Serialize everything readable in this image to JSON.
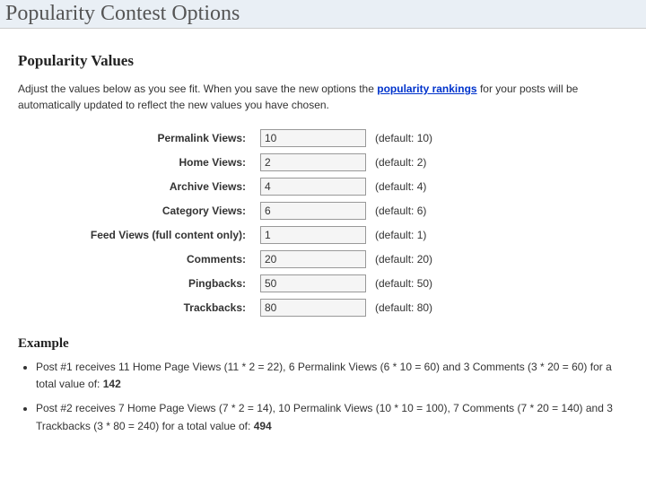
{
  "page_title": "Popularity Contest Options",
  "section_heading": "Popularity Values",
  "intro_pre": "Adjust the values below as you see fit. When you save the new options the ",
  "intro_link": "popularity rankings",
  "intro_post": " for your posts will be automatically updated to reflect the new values you have chosen.",
  "fields": {
    "permalink": {
      "label": "Permalink Views:",
      "value": "10",
      "default": "(default: 10)"
    },
    "home": {
      "label": "Home Views:",
      "value": "2",
      "default": "(default: 2)"
    },
    "archive": {
      "label": "Archive Views:",
      "value": "4",
      "default": "(default: 4)"
    },
    "category": {
      "label": "Category Views:",
      "value": "6",
      "default": "(default: 6)"
    },
    "feed": {
      "label": "Feed Views (full content only):",
      "value": "1",
      "default": "(default: 1)"
    },
    "comments": {
      "label": "Comments:",
      "value": "20",
      "default": "(default: 20)"
    },
    "pingbacks": {
      "label": "Pingbacks:",
      "value": "50",
      "default": "(default: 50)"
    },
    "trackbacks": {
      "label": "Trackbacks:",
      "value": "80",
      "default": "(default: 80)"
    }
  },
  "example_heading": "Example",
  "examples": {
    "e1_text": "Post #1 receives 11 Home Page Views (11 * 2 = 22), 6 Permalink Views (6 * 10 = 60) and 3 Comments (3 * 20 = 60) for a total value of: ",
    "e1_total": "142",
    "e2_text": "Post #2 receives 7 Home Page Views (7 * 2 = 14), 10 Permalink Views (10 * 10 = 100), 7 Comments (7 * 20 = 140) and 3 Trackbacks (3 * 80 = 240) for a total value of: ",
    "e2_total": "494"
  }
}
